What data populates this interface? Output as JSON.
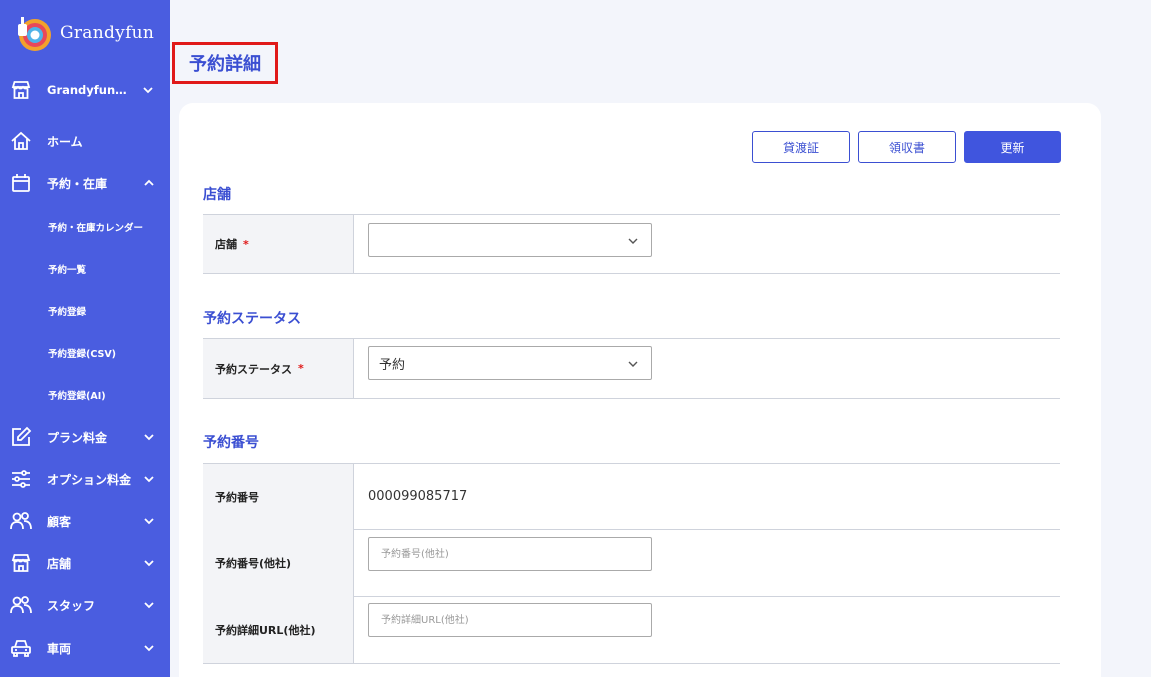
{
  "sidebar": {
    "brand": "Grandyfun",
    "store_selector": "Grandyfun…",
    "items": {
      "home": "ホーム",
      "reservation": "予約・在庫",
      "plan": "プラン料金",
      "option": "オプション料金",
      "customer": "顧客",
      "store": "店舗",
      "staff": "スタッフ",
      "vehicle": "車両"
    },
    "sub_items": {
      "calendar": "予約・在庫カレンダー",
      "list": "予約一覧",
      "register": "予約登録",
      "register_csv": "予約登録(CSV)",
      "register_ai": "予約登録(AI)"
    }
  },
  "page": {
    "title": "予約詳細"
  },
  "actions": {
    "loan_certificate": "貸渡証",
    "receipt": "領収書",
    "update": "更新"
  },
  "sections": {
    "store": {
      "title": "店舗",
      "label": "店舗",
      "required_mark": "*",
      "value": ""
    },
    "status": {
      "title": "予約ステータス",
      "label": "予約ステータス",
      "required_mark": "*",
      "value": "予約"
    },
    "number": {
      "title": "予約番号",
      "label": "予約番号",
      "value": "000099085717",
      "other_label": "予約番号(他社)",
      "other_placeholder": "予約番号(他社)",
      "url_label": "予約詳細URL(他社)",
      "url_placeholder": "予約詳細URL(他社)"
    }
  },
  "colors": {
    "sidebar": "#4a5de0",
    "accent": "#3b4fd2",
    "required": "#e01919",
    "highlight_border": "#e01919"
  }
}
